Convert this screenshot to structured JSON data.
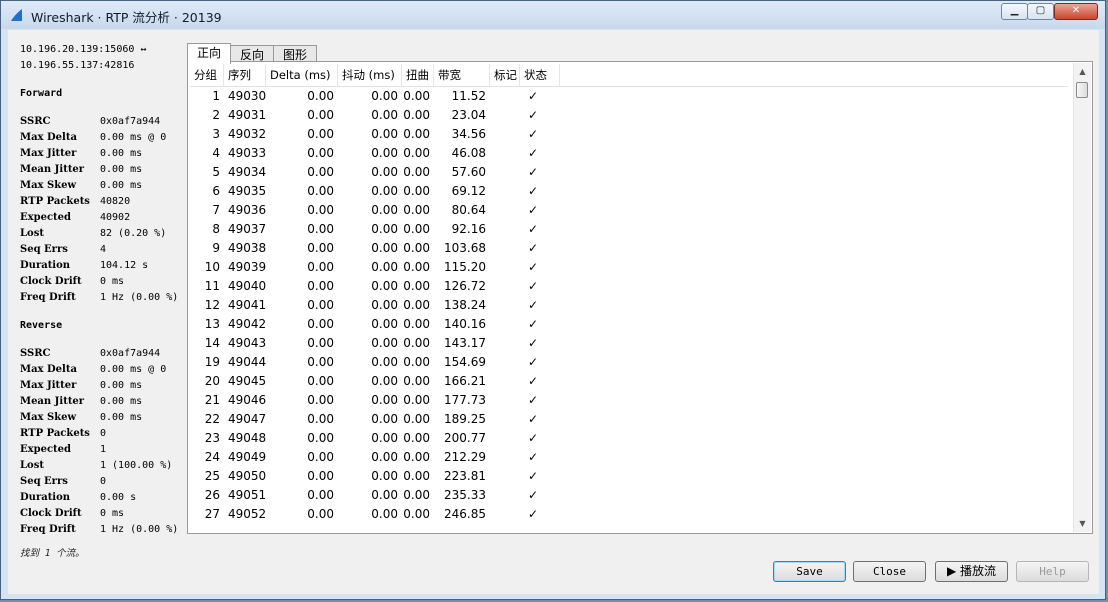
{
  "window": {
    "title": "Wireshark · RTP 流分析 · 20139"
  },
  "stats": {
    "endpoints": [
      "10.196.20.139:15060 ↔",
      "10.196.55.137:42816"
    ],
    "forward_heading": "Forward",
    "forward": [
      {
        "k": "SSRC",
        "v": "0x0af7a944"
      },
      {
        "k": "Max Delta",
        "v": "0.00 ms @ 0"
      },
      {
        "k": "Max Jitter",
        "v": "0.00 ms"
      },
      {
        "k": "Mean Jitter",
        "v": "0.00 ms"
      },
      {
        "k": "Max Skew",
        "v": "0.00 ms"
      },
      {
        "k": "RTP Packets",
        "v": "40820"
      },
      {
        "k": "Expected",
        "v": "40902"
      },
      {
        "k": "Lost",
        "v": "82 (0.20 %)"
      },
      {
        "k": "Seq Errs",
        "v": "4"
      },
      {
        "k": "Duration",
        "v": "104.12 s"
      },
      {
        "k": "Clock Drift",
        "v": "0 ms"
      },
      {
        "k": "Freq Drift",
        "v": "1 Hz (0.00 %)"
      }
    ],
    "reverse_heading": "Reverse",
    "reverse": [
      {
        "k": "SSRC",
        "v": "0x0af7a944"
      },
      {
        "k": "Max Delta",
        "v": "0.00 ms @ 0"
      },
      {
        "k": "Max Jitter",
        "v": "0.00 ms"
      },
      {
        "k": "Mean Jitter",
        "v": "0.00 ms"
      },
      {
        "k": "Max Skew",
        "v": "0.00 ms"
      },
      {
        "k": "RTP Packets",
        "v": "0"
      },
      {
        "k": "Expected",
        "v": "1"
      },
      {
        "k": "Lost",
        "v": "1 (100.00 %)"
      },
      {
        "k": "Seq Errs",
        "v": "0"
      },
      {
        "k": "Duration",
        "v": "0.00 s"
      },
      {
        "k": "Clock Drift",
        "v": "0 ms"
      },
      {
        "k": "Freq Drift",
        "v": "1 Hz (0.00 %)"
      }
    ],
    "found": "找到 1 个流。"
  },
  "tabs": [
    "正向",
    "反向",
    "图形"
  ],
  "table": {
    "headers": [
      "分组",
      "序列",
      "Delta (ms)",
      "抖动 (ms)",
      "扭曲",
      "带宽",
      "标记",
      "状态"
    ],
    "rows": [
      [
        "1",
        "49030",
        "0.00",
        "0.00",
        "0.00",
        "11.52",
        "",
        "✓"
      ],
      [
        "2",
        "49031",
        "0.00",
        "0.00",
        "0.00",
        "23.04",
        "",
        "✓"
      ],
      [
        "3",
        "49032",
        "0.00",
        "0.00",
        "0.00",
        "34.56",
        "",
        "✓"
      ],
      [
        "4",
        "49033",
        "0.00",
        "0.00",
        "0.00",
        "46.08",
        "",
        "✓"
      ],
      [
        "5",
        "49034",
        "0.00",
        "0.00",
        "0.00",
        "57.60",
        "",
        "✓"
      ],
      [
        "6",
        "49035",
        "0.00",
        "0.00",
        "0.00",
        "69.12",
        "",
        "✓"
      ],
      [
        "7",
        "49036",
        "0.00",
        "0.00",
        "0.00",
        "80.64",
        "",
        "✓"
      ],
      [
        "8",
        "49037",
        "0.00",
        "0.00",
        "0.00",
        "92.16",
        "",
        "✓"
      ],
      [
        "9",
        "49038",
        "0.00",
        "0.00",
        "0.00",
        "103.68",
        "",
        "✓"
      ],
      [
        "10",
        "49039",
        "0.00",
        "0.00",
        "0.00",
        "115.20",
        "",
        "✓"
      ],
      [
        "11",
        "49040",
        "0.00",
        "0.00",
        "0.00",
        "126.72",
        "",
        "✓"
      ],
      [
        "12",
        "49041",
        "0.00",
        "0.00",
        "0.00",
        "138.24",
        "",
        "✓"
      ],
      [
        "13",
        "49042",
        "0.00",
        "0.00",
        "0.00",
        "140.16",
        "",
        "✓"
      ],
      [
        "14",
        "49043",
        "0.00",
        "0.00",
        "0.00",
        "143.17",
        "",
        "✓"
      ],
      [
        "19",
        "49044",
        "0.00",
        "0.00",
        "0.00",
        "154.69",
        "",
        "✓"
      ],
      [
        "20",
        "49045",
        "0.00",
        "0.00",
        "0.00",
        "166.21",
        "",
        "✓"
      ],
      [
        "21",
        "49046",
        "0.00",
        "0.00",
        "0.00",
        "177.73",
        "",
        "✓"
      ],
      [
        "22",
        "49047",
        "0.00",
        "0.00",
        "0.00",
        "189.25",
        "",
        "✓"
      ],
      [
        "23",
        "49048",
        "0.00",
        "0.00",
        "0.00",
        "200.77",
        "",
        "✓"
      ],
      [
        "24",
        "49049",
        "0.00",
        "0.00",
        "0.00",
        "212.29",
        "",
        "✓"
      ],
      [
        "25",
        "49050",
        "0.00",
        "0.00",
        "0.00",
        "223.81",
        "",
        "✓"
      ],
      [
        "26",
        "49051",
        "0.00",
        "0.00",
        "0.00",
        "235.33",
        "",
        "✓"
      ],
      [
        "27",
        "49052",
        "0.00",
        "0.00",
        "0.00",
        "246.85",
        "",
        "✓"
      ]
    ]
  },
  "buttons": {
    "save": "Save",
    "close": "Close",
    "play": "▶ 播放流",
    "help": "Help"
  }
}
